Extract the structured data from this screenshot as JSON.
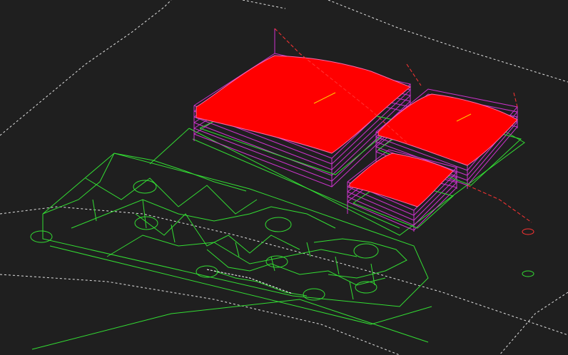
{
  "viewport": {
    "background": "#1f1f1f",
    "colors": {
      "boundary": "#ffffff",
      "wireframe": "#33dd33",
      "toolpath": "#cc33cc",
      "surface": "#ff0000",
      "surface_stroke": "#ff66aa",
      "axis": "#ff3333",
      "normal": "#ffcc00"
    },
    "icons": [
      "work-boundary-icon",
      "toolpath-stack-icon",
      "cad-wireframe-icon",
      "origin-marker-icon"
    ]
  }
}
